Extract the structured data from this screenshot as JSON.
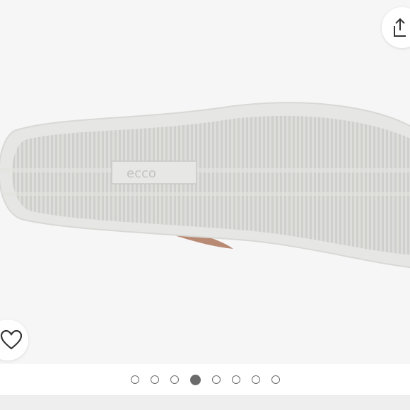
{
  "product_image": {
    "brand_text": "ecco",
    "background_color": "#f6f6f6",
    "sole_color": "#e3e3e1",
    "upper_color": "#b98a73"
  },
  "share_button": {
    "icon": "share-icon"
  },
  "favorite_button": {
    "icon": "heart-outline-icon"
  },
  "carousel": {
    "total": 8,
    "active_index": 3
  }
}
